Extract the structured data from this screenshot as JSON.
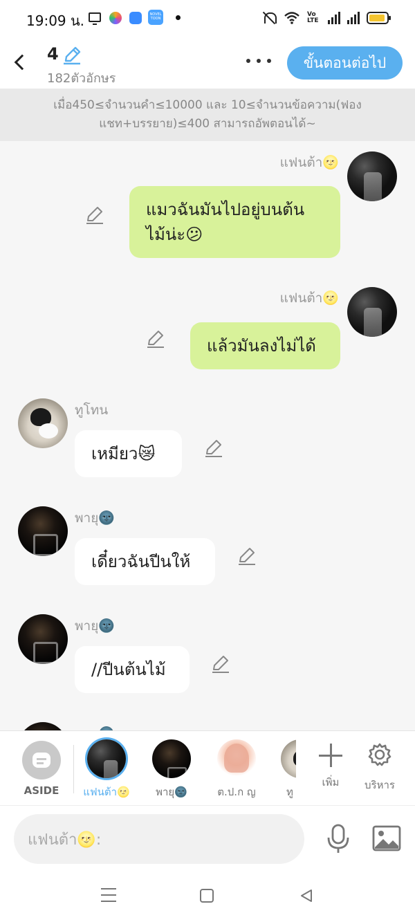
{
  "status_bar": {
    "time": "19:09 น.",
    "icons": [
      "monitor-icon",
      "app-icon",
      "app-icon",
      "noveltoon-icon",
      "dot-icon",
      "mute-icon",
      "wifi-icon",
      "volte-icon",
      "signal-icon",
      "signal-icon",
      "battery-icon"
    ],
    "volte_text": "Vo\nLTE",
    "app3_text": "NOVEL TOON"
  },
  "header": {
    "episode_number": "4",
    "char_count": "182ตัวอักษร",
    "next_button_label": "ขั้นตอนต่อไป",
    "accent_color": "#5ab0ef"
  },
  "notice": {
    "text": "เมื่อ450≤จำนวนคำ≤10000 และ 10≤จำนวนข้อความ(ฟองแชท+บรรยาย)≤400 สามารถอัพตอนได้~"
  },
  "messages": [
    {
      "speaker": "แฟนต้า🌝",
      "text": "แมวฉันมันไปอยู่บนต้นไม้น่ะ😕",
      "side": "right",
      "avatar": "night"
    },
    {
      "speaker": "แฟนต้า🌝",
      "text": "แล้วมันลงไม่ได้",
      "side": "right",
      "avatar": "night"
    },
    {
      "speaker": "ทูโทน",
      "text": "เหมียว😿",
      "side": "left",
      "avatar": "cat"
    },
    {
      "speaker": "พายุ🌚",
      "text": "เดี๋ยวฉันปีนให้",
      "side": "left",
      "avatar": "dark"
    },
    {
      "speaker": "พายุ🌚",
      "text": "//ปีนต้นไม้",
      "side": "left",
      "avatar": "dark"
    },
    {
      "speaker": "พายุ🌚",
      "text": "",
      "side": "left",
      "avatar": "dark"
    }
  ],
  "character_bar": {
    "aside_label": "ASIDE",
    "characters": [
      {
        "label": "แฟนต้า🌝",
        "avatar": "night",
        "selected": true
      },
      {
        "label": "พายุ🌚",
        "avatar": "dark",
        "selected": false
      },
      {
        "label": "ต.ป.ก ญ",
        "avatar": "girl",
        "selected": false
      },
      {
        "label": "ทู",
        "avatar": "cat",
        "selected": false
      }
    ],
    "add_label": "เพิ่ม",
    "manage_label": "บริหาร"
  },
  "input": {
    "placeholder": "แฟนต้า🌝:"
  },
  "nav": {
    "buttons": [
      "menu-icon",
      "home-icon",
      "back-icon"
    ]
  }
}
